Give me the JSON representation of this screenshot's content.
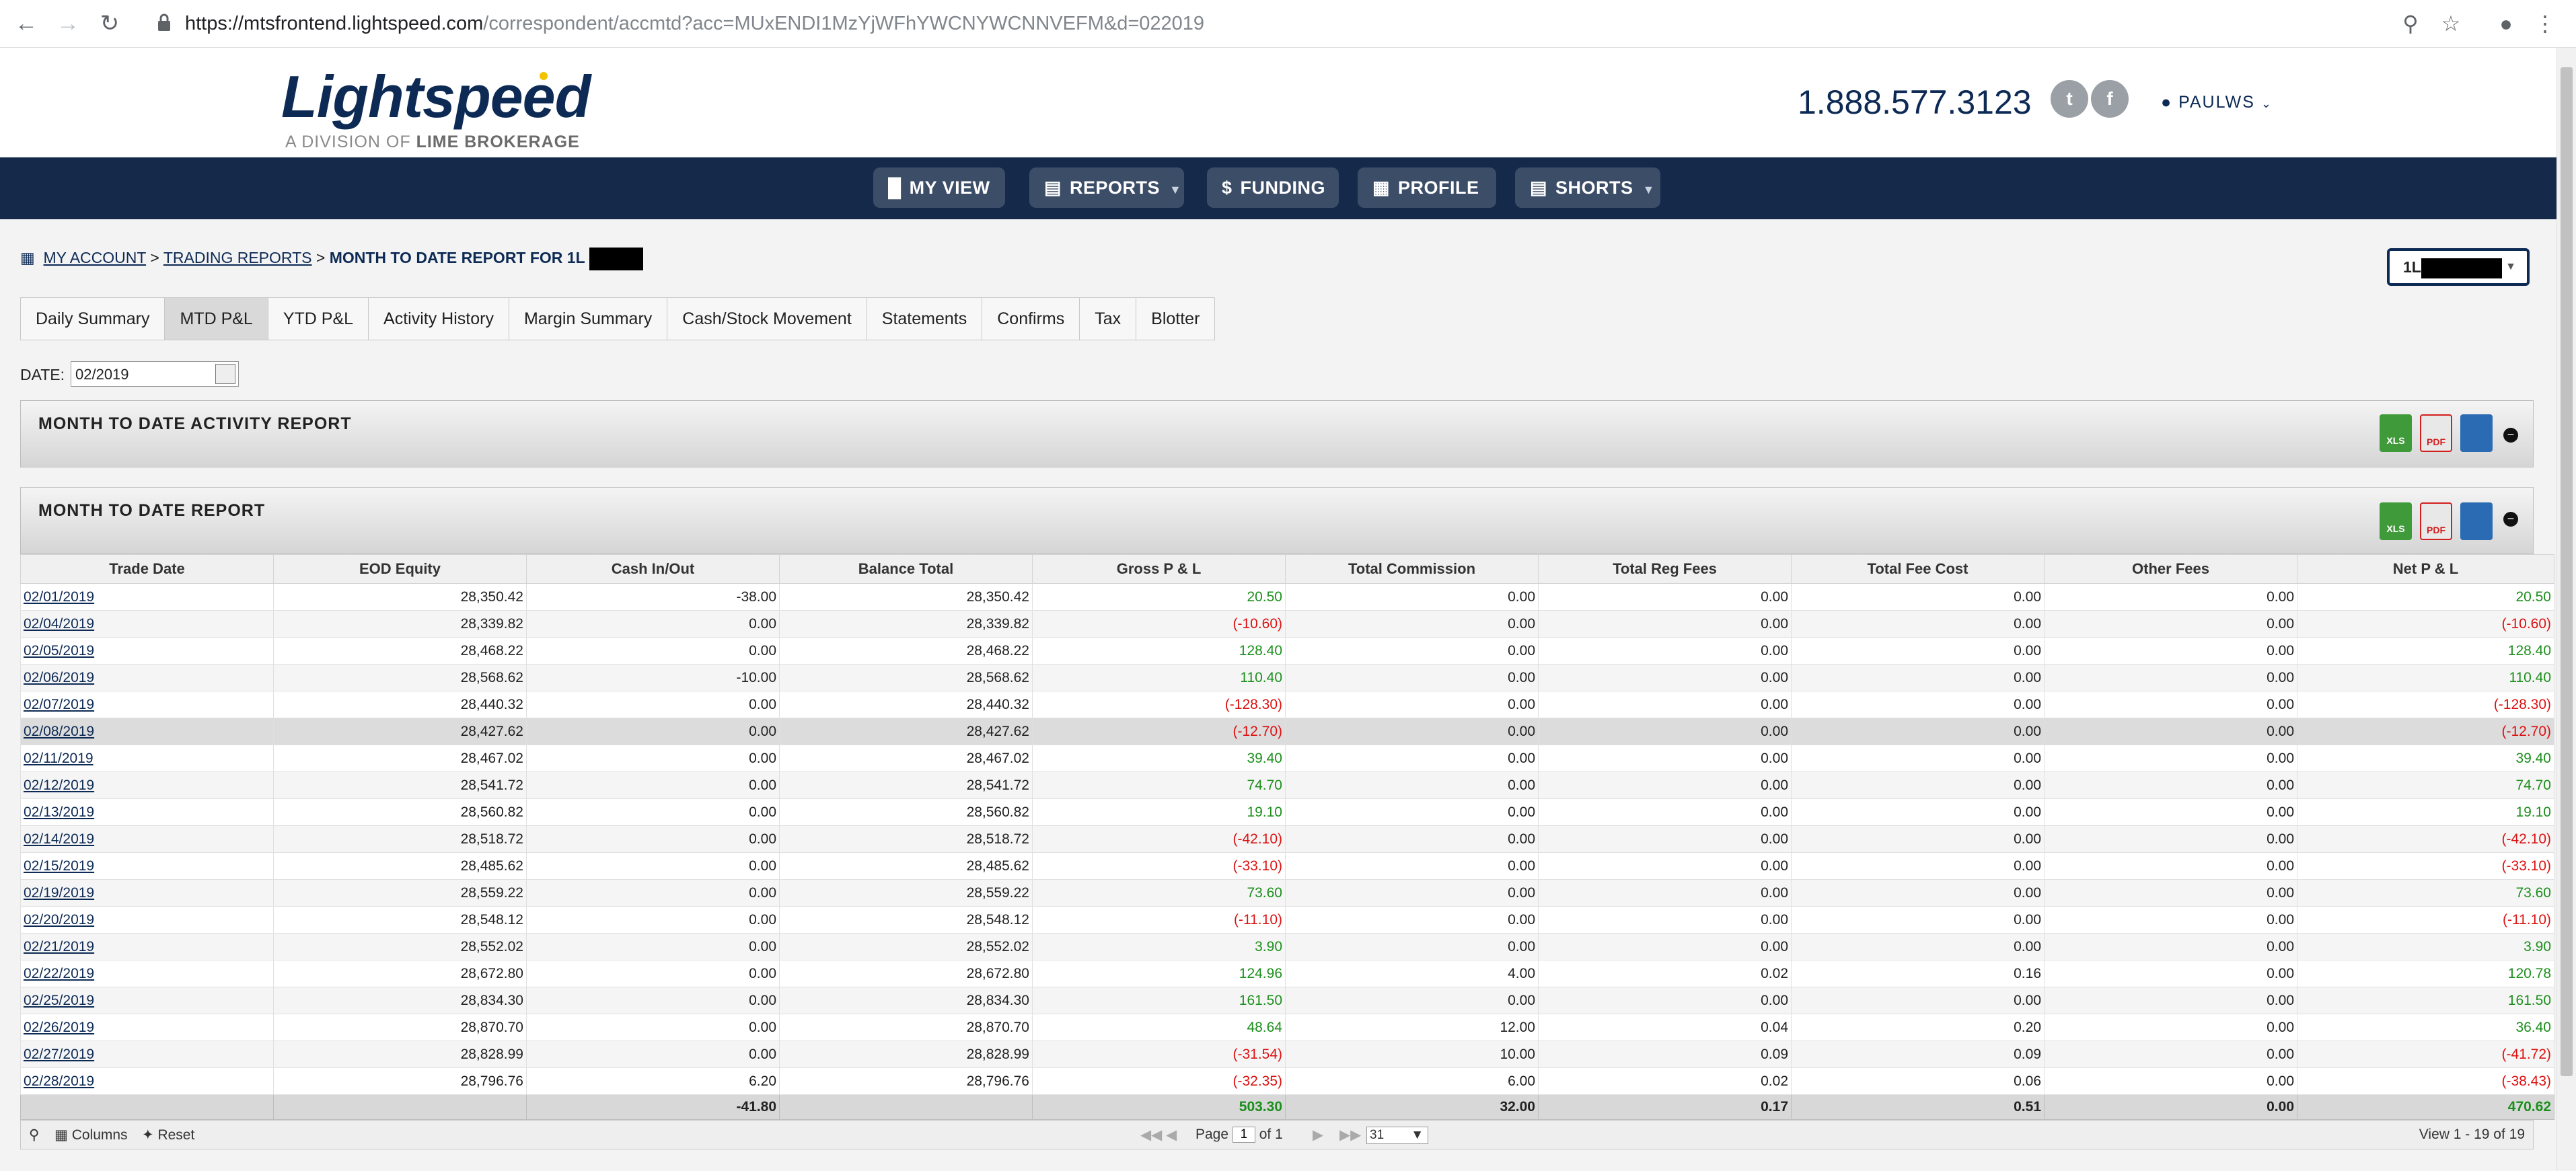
{
  "browser": {
    "url_host": "https://mtsfrontend.lightspeed.com",
    "url_path": "/correspondent/accmtd?acc=MUxENDI1MzYjWFhYWCNYWCNNVEFM&d=022019",
    "back_icon": "arrow-left-icon",
    "forward_icon": "arrow-right-icon",
    "reload_icon": "reload-icon"
  },
  "header": {
    "logo_text": "Lightspeed",
    "logo_sub_prefix": "A DIVISION OF ",
    "logo_sub_bold": "LIME BROKERAGE",
    "phone": "1.888.577.3123",
    "user": "PAULWS"
  },
  "nav": {
    "items": [
      {
        "label": "MY VIEW"
      },
      {
        "label": "REPORTS"
      },
      {
        "label": "FUNDING"
      },
      {
        "label": "PROFILE"
      },
      {
        "label": "SHORTS"
      }
    ]
  },
  "breadcrumb": {
    "my_account": "MY ACCOUNT",
    "sep": ">",
    "trading_reports": "TRADING REPORTS",
    "current": "MONTH TO DATE REPORT FOR 1L"
  },
  "account_select": {
    "value": "1L"
  },
  "tabs": [
    {
      "label": "Daily Summary"
    },
    {
      "label": "MTD P&L"
    },
    {
      "label": "YTD P&L"
    },
    {
      "label": "Activity History"
    },
    {
      "label": "Margin Summary"
    },
    {
      "label": "Cash/Stock Movement"
    },
    {
      "label": "Statements"
    },
    {
      "label": "Confirms"
    },
    {
      "label": "Tax"
    },
    {
      "label": "Blotter"
    }
  ],
  "date_filter": {
    "label": "DATE:",
    "value": "02/2019"
  },
  "panels": {
    "activity_title": "MONTH TO DATE ACTIVITY REPORT",
    "report_title": "MONTH TO DATE REPORT",
    "xls_label": "XLS",
    "pdf_label": "PDF"
  },
  "table": {
    "columns": [
      "Trade Date",
      "EOD Equity",
      "Cash In/Out",
      "Balance Total",
      "Gross P & L",
      "Total Commission",
      "Total Reg Fees",
      "Total Fee Cost",
      "Other Fees",
      "Net P & L"
    ],
    "rows": [
      [
        "02/01/2019",
        "28,350.42",
        "-38.00",
        "28,350.42",
        "20.50",
        "0.00",
        "0.00",
        "0.00",
        "0.00",
        "20.50"
      ],
      [
        "02/04/2019",
        "28,339.82",
        "0.00",
        "28,339.82",
        "(-10.60)",
        "0.00",
        "0.00",
        "0.00",
        "0.00",
        "(-10.60)"
      ],
      [
        "02/05/2019",
        "28,468.22",
        "0.00",
        "28,468.22",
        "128.40",
        "0.00",
        "0.00",
        "0.00",
        "0.00",
        "128.40"
      ],
      [
        "02/06/2019",
        "28,568.62",
        "-10.00",
        "28,568.62",
        "110.40",
        "0.00",
        "0.00",
        "0.00",
        "0.00",
        "110.40"
      ],
      [
        "02/07/2019",
        "28,440.32",
        "0.00",
        "28,440.32",
        "(-128.30)",
        "0.00",
        "0.00",
        "0.00",
        "0.00",
        "(-128.30)"
      ],
      [
        "02/08/2019",
        "28,427.62",
        "0.00",
        "28,427.62",
        "(-12.70)",
        "0.00",
        "0.00",
        "0.00",
        "0.00",
        "(-12.70)"
      ],
      [
        "02/11/2019",
        "28,467.02",
        "0.00",
        "28,467.02",
        "39.40",
        "0.00",
        "0.00",
        "0.00",
        "0.00",
        "39.40"
      ],
      [
        "02/12/2019",
        "28,541.72",
        "0.00",
        "28,541.72",
        "74.70",
        "0.00",
        "0.00",
        "0.00",
        "0.00",
        "74.70"
      ],
      [
        "02/13/2019",
        "28,560.82",
        "0.00",
        "28,560.82",
        "19.10",
        "0.00",
        "0.00",
        "0.00",
        "0.00",
        "19.10"
      ],
      [
        "02/14/2019",
        "28,518.72",
        "0.00",
        "28,518.72",
        "(-42.10)",
        "0.00",
        "0.00",
        "0.00",
        "0.00",
        "(-42.10)"
      ],
      [
        "02/15/2019",
        "28,485.62",
        "0.00",
        "28,485.62",
        "(-33.10)",
        "0.00",
        "0.00",
        "0.00",
        "0.00",
        "(-33.10)"
      ],
      [
        "02/19/2019",
        "28,559.22",
        "0.00",
        "28,559.22",
        "73.60",
        "0.00",
        "0.00",
        "0.00",
        "0.00",
        "73.60"
      ],
      [
        "02/20/2019",
        "28,548.12",
        "0.00",
        "28,548.12",
        "(-11.10)",
        "0.00",
        "0.00",
        "0.00",
        "0.00",
        "(-11.10)"
      ],
      [
        "02/21/2019",
        "28,552.02",
        "0.00",
        "28,552.02",
        "3.90",
        "0.00",
        "0.00",
        "0.00",
        "0.00",
        "3.90"
      ],
      [
        "02/22/2019",
        "28,672.80",
        "0.00",
        "28,672.80",
        "124.96",
        "4.00",
        "0.02",
        "0.16",
        "0.00",
        "120.78"
      ],
      [
        "02/25/2019",
        "28,834.30",
        "0.00",
        "28,834.30",
        "161.50",
        "0.00",
        "0.00",
        "0.00",
        "0.00",
        "161.50"
      ],
      [
        "02/26/2019",
        "28,870.70",
        "0.00",
        "28,870.70",
        "48.64",
        "12.00",
        "0.04",
        "0.20",
        "0.00",
        "36.40"
      ],
      [
        "02/27/2019",
        "28,828.99",
        "0.00",
        "28,828.99",
        "(-31.54)",
        "10.00",
        "0.09",
        "0.09",
        "0.00",
        "(-41.72)"
      ],
      [
        "02/28/2019",
        "28,796.76",
        "6.20",
        "28,796.76",
        "(-32.35)",
        "6.00",
        "0.02",
        "0.06",
        "0.00",
        "(-38.43)"
      ]
    ],
    "totals": [
      "",
      "",
      "-41.80",
      "",
      "503.30",
      "32.00",
      "0.17",
      "0.51",
      "0.00",
      "470.62"
    ],
    "selected_row": 5
  },
  "pager": {
    "columns_label": "Columns",
    "reset_label": "Reset",
    "page_label": "Page",
    "page_value": "1",
    "of_label": "of 1",
    "rows_per_page": "31",
    "view_text": "View 1 - 19 of 19"
  },
  "colors": {
    "navy": "#0d2a55",
    "nav_bg": "#152a4a",
    "positive": "#1b8f1b",
    "negative": "#d11111"
  }
}
